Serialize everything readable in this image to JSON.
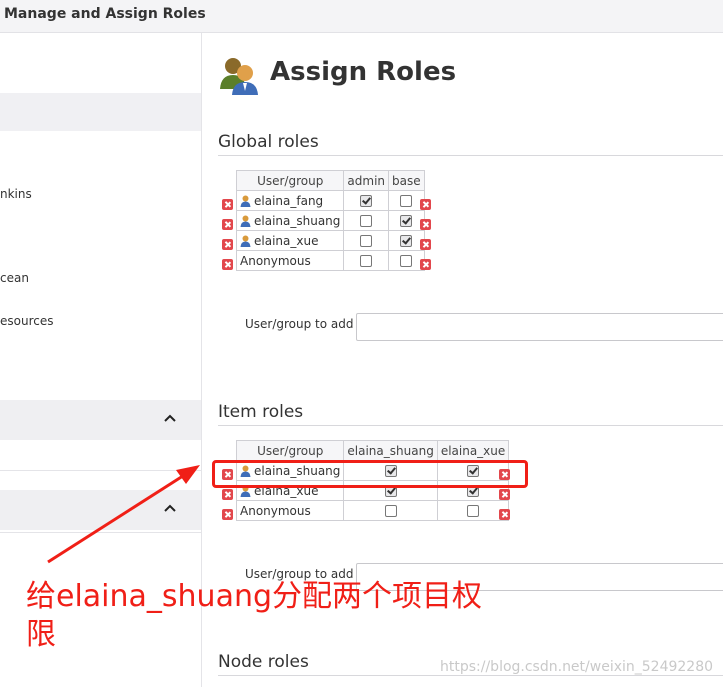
{
  "window": {
    "title": "Manage and Assign Roles"
  },
  "sidebar": {
    "items": [
      {
        "label": "nkins"
      },
      {
        "label": "cean"
      },
      {
        "label": "esources"
      }
    ]
  },
  "page": {
    "title": "Assign Roles",
    "icon": "users-icon"
  },
  "global_roles": {
    "heading": "Global roles",
    "header": [
      "User/group",
      "admin",
      "base"
    ],
    "rows": [
      {
        "name": "elaina_fang",
        "user_icon": true,
        "checks": [
          true,
          false
        ]
      },
      {
        "name": "elaina_shuang",
        "user_icon": true,
        "checks": [
          false,
          true
        ]
      },
      {
        "name": "elaina_xue",
        "user_icon": true,
        "checks": [
          false,
          true
        ]
      },
      {
        "name": "Anonymous",
        "user_icon": false,
        "checks": [
          false,
          false
        ]
      }
    ],
    "add_label": "User/group to add",
    "add_value": ""
  },
  "item_roles": {
    "heading": "Item roles",
    "header": [
      "User/group",
      "elaina_shuang",
      "elaina_xue"
    ],
    "rows": [
      {
        "name": "elaina_shuang",
        "user_icon": true,
        "checks": [
          true,
          true
        ]
      },
      {
        "name": "elaina_xue",
        "user_icon": true,
        "checks": [
          true,
          true
        ]
      },
      {
        "name": "Anonymous",
        "user_icon": false,
        "checks": [
          false,
          false
        ]
      }
    ],
    "add_label": "User/group to add",
    "add_value": ""
  },
  "node_roles": {
    "heading": "Node roles"
  },
  "annotation": {
    "text": "给elaina_shuang分配两个项目权限",
    "color": "#f01f17"
  },
  "watermark": "https://blog.csdn.net/weixin_52492280"
}
